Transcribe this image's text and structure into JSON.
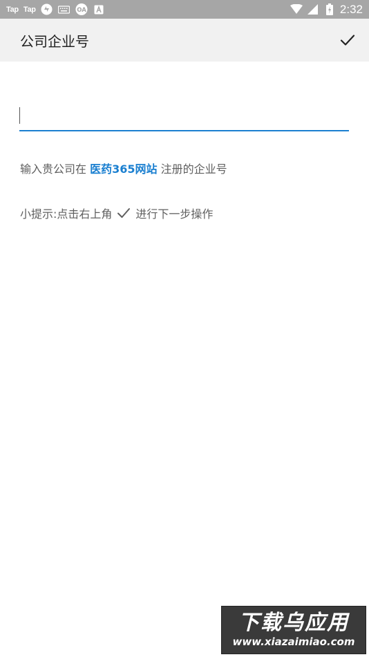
{
  "status_bar": {
    "left_items": [
      "Tap",
      "Tap"
    ],
    "icons": [
      "sync-icon",
      "keyboard-icon",
      "cloud-icon",
      "a-icon"
    ],
    "right_icons": [
      "wifi-icon",
      "signal-icon",
      "battery-icon"
    ],
    "time": "2:32"
  },
  "app_bar": {
    "title": "公司企业号",
    "confirm_icon": "check-icon"
  },
  "form": {
    "input_value": "",
    "input_placeholder": ""
  },
  "hint": {
    "prefix": "输入贵公司在 ",
    "site": "医药365网站",
    "suffix": " 注册的企业号"
  },
  "tip": {
    "prefix": "小提示:点击右上角",
    "suffix": "进行下一步操作"
  },
  "watermark": {
    "title": "下载乌应用",
    "url": "www.xiazaimiao.com"
  },
  "colors": {
    "accent": "#1a7fd0",
    "status_bar": "#a6a6a6",
    "app_bar": "#f1f1f1",
    "text_secondary": "#5f5f5f"
  }
}
